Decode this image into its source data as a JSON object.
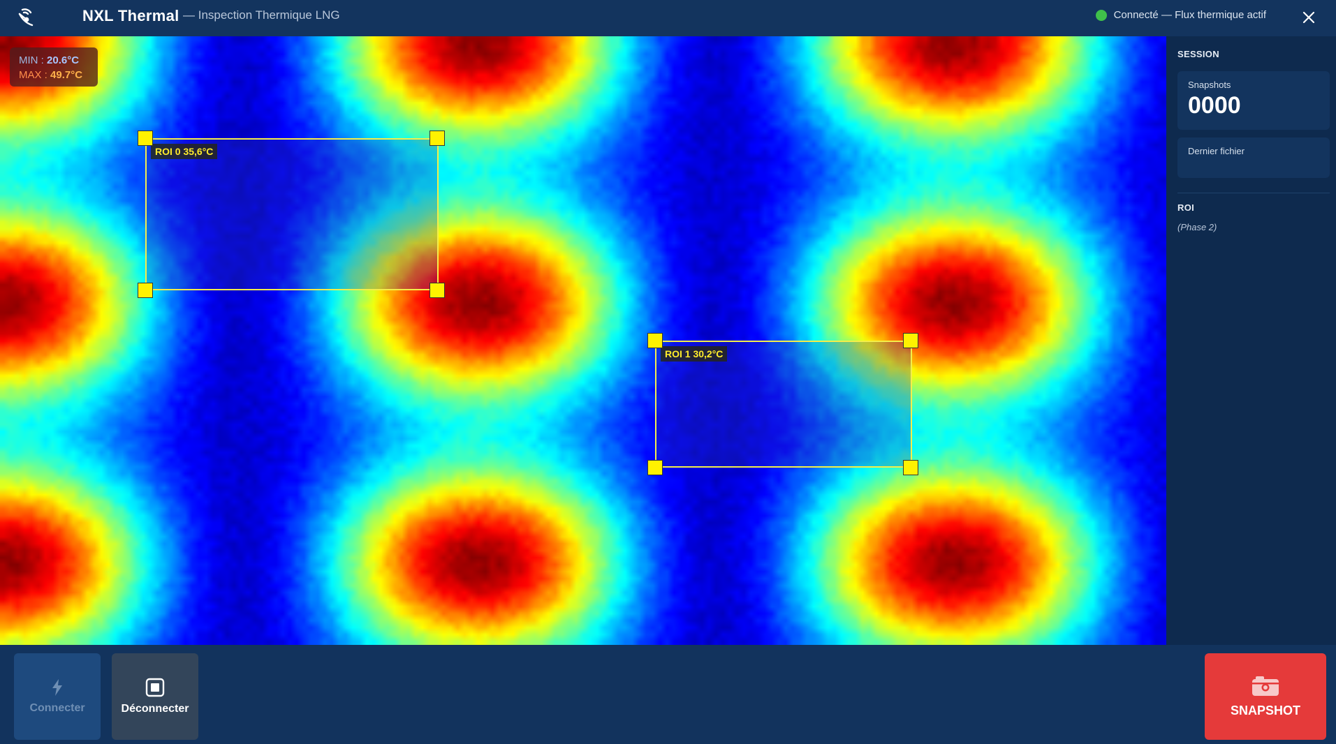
{
  "titlebar": {
    "app_name": "NXL Thermal",
    "subtitle": "— Inspection Thermique LNG",
    "status_text": "Connecté — Flux thermique actif",
    "status_color": "#3fbf4a",
    "app_icon": "satellite-dish-icon",
    "close_icon": "close-icon"
  },
  "thermal": {
    "min_label": "MIN :",
    "min_value": "20.6°C",
    "max_label": "MAX :",
    "max_value": "49.7°C",
    "rois": [
      {
        "label": "ROI 0  35,6°C"
      },
      {
        "label": "ROI 1  30,2°C"
      }
    ]
  },
  "session": {
    "title": "SESSION",
    "snapshots_label": "Snapshots",
    "snapshots_value": "0000",
    "last_file_label": "Dernier fichier",
    "last_file_value": ""
  },
  "roi_section": {
    "title": "ROI",
    "note": "(Phase 2)"
  },
  "bottombar": {
    "connect_label": "Connecter",
    "connect_icon": "lightning-bolt-icon",
    "disconnect_label": "Déconnecter",
    "disconnect_icon": "stop-square-icon",
    "snapshot_label": "SNAPSHOT",
    "snapshot_icon": "camera-icon",
    "snapshot_color": "#e53a3a"
  }
}
